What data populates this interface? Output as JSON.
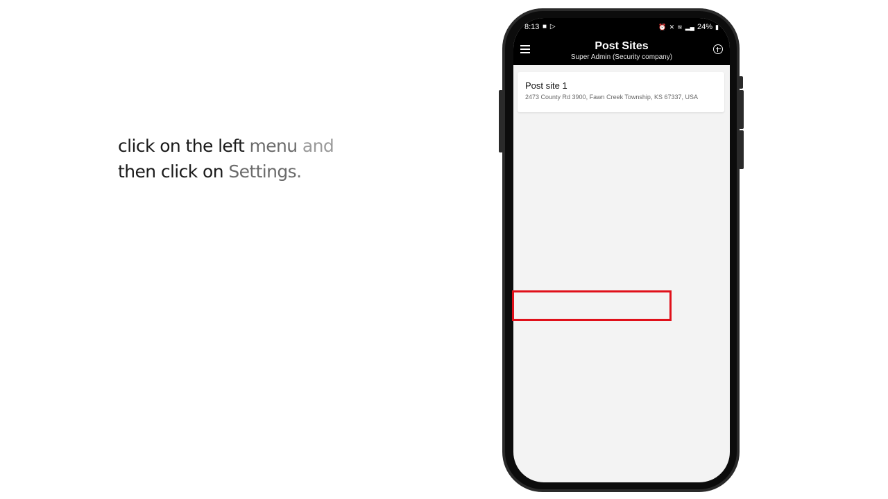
{
  "instruction": {
    "line1_a": "click on the left ",
    "line1_b": "menu ",
    "line1_c": "and",
    "line2_a": "then click on ",
    "line2_b": "Settings."
  },
  "status_bar": {
    "time": "8:13",
    "left_icons": [
      "camera-icon",
      "play-store-icon"
    ],
    "right_icons": [
      "alarm-icon",
      "mute-icon",
      "wifi-icon",
      "volte-icon",
      "signal-icon"
    ],
    "battery": "24%"
  },
  "app_bar": {
    "title": "Post Sites",
    "subtitle": "Super Admin (Security company)",
    "left_icon": "menu-icon",
    "right_icon": "add-circle-icon"
  },
  "post_sites": [
    {
      "name": "Post site 1",
      "address": "2473 County Rd 3900, Fawn Creek Township, KS 67337, USA"
    }
  ],
  "colors": {
    "highlight": "#e0101a",
    "app_bar": "#000000",
    "background": "#f3f3f3"
  }
}
